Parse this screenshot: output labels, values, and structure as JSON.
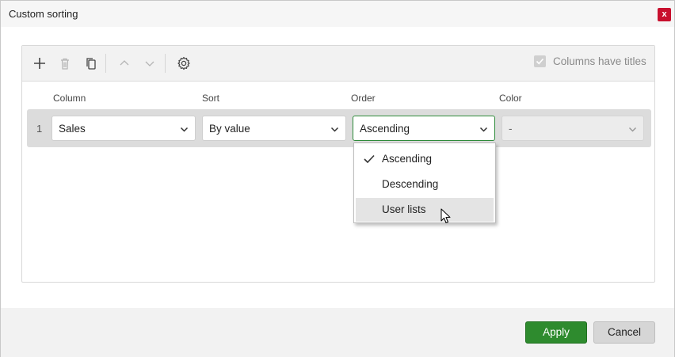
{
  "window": {
    "title": "Custom sorting",
    "close_label": "x"
  },
  "toolbar": {
    "icons": [
      "plus-icon",
      "trash-icon",
      "copy-icon",
      "chevron-up-icon",
      "chevron-down-icon",
      "gear-icon"
    ],
    "columns_have_titles": {
      "label": "Columns have titles",
      "checked": true
    }
  },
  "grid": {
    "headers": {
      "column": "Column",
      "sort": "Sort",
      "order": "Order",
      "color": "Color"
    },
    "rows": [
      {
        "number": "1",
        "column": "Sales",
        "sort": "By value",
        "order": "Ascending",
        "color": "-"
      }
    ]
  },
  "order_dropdown": {
    "options": [
      "Ascending",
      "Descending",
      "User lists"
    ],
    "selected": "Ascending",
    "hovered": "User lists"
  },
  "footer": {
    "apply_label": "Apply",
    "cancel_label": "Cancel"
  },
  "colors": {
    "accent": "#2e8b2e",
    "close": "#c8102e"
  }
}
